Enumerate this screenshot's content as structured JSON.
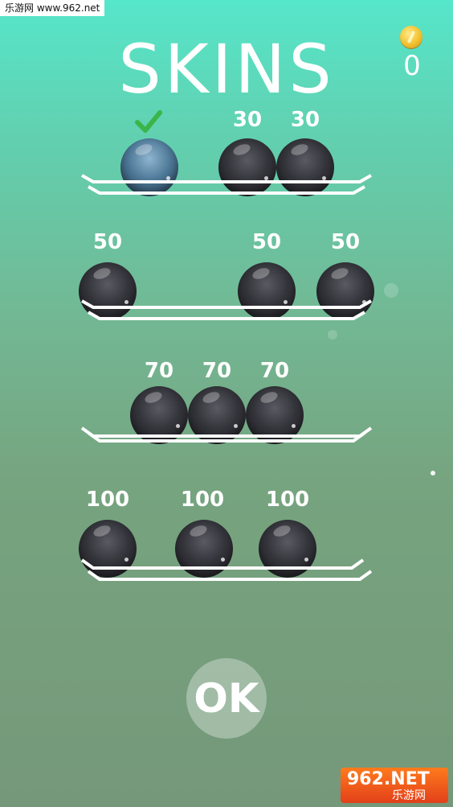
{
  "watermark_top": "乐游网 www.962.net",
  "header": {
    "title": "SKINS",
    "coin_icon": "coin-icon",
    "coin_count": "0"
  },
  "rows": [
    {
      "prices": [
        "",
        "30",
        "30"
      ],
      "selected_index": 0
    },
    {
      "prices": [
        "50",
        "50",
        "50"
      ]
    },
    {
      "prices": [
        "70",
        "70",
        "70"
      ]
    },
    {
      "prices": [
        "100",
        "100",
        "100"
      ]
    }
  ],
  "ok_button": {
    "label": "OK"
  },
  "watermark_bottom": {
    "brand": "962.NET",
    "name": "乐游网"
  },
  "colors": {
    "check": "#3bb54a",
    "text": "#ffffff"
  }
}
